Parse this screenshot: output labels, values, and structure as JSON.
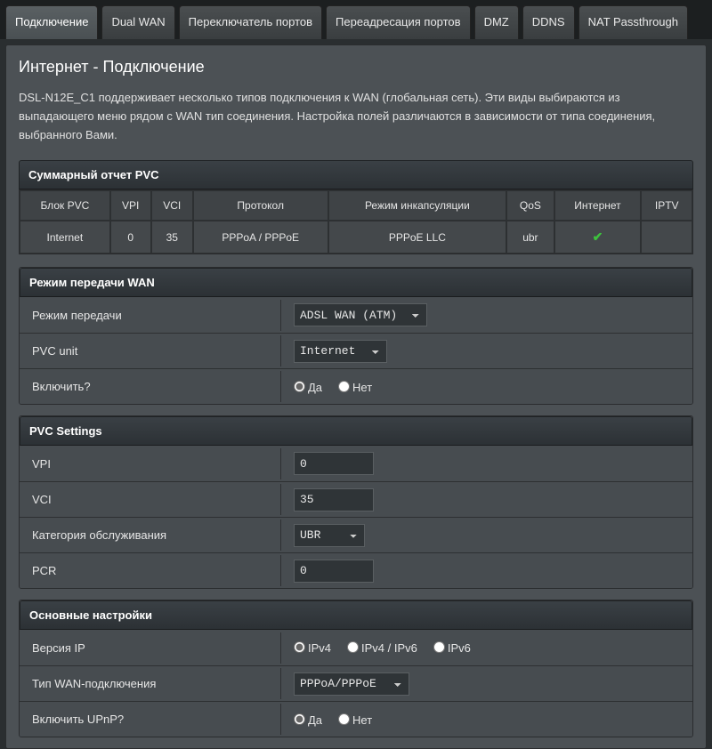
{
  "tabs": {
    "items": [
      "Подключение",
      "Dual WAN",
      "Переключатель портов",
      "Переадресация портов",
      "DMZ",
      "DDNS",
      "NAT Passthrough"
    ],
    "active_index": 0
  },
  "page": {
    "title": "Интернет - Подключение",
    "description": "DSL-N12E_C1 поддерживает несколько типов подключения к WAN (глобальная сеть). Эти виды выбираются из выпадающего меню рядом с WAN тип соединения. Настройка полей различаются в зависимости от типа соединения, выбранного Вами."
  },
  "summary": {
    "heading": "Суммарный отчет PVC",
    "columns": [
      "Блок PVC",
      "VPI",
      "VCI",
      "Протокол",
      "Режим инкапсуляции",
      "QoS",
      "Интернет",
      "IPTV"
    ],
    "row": {
      "block": "Internet",
      "vpi": "0",
      "vci": "35",
      "protocol": "PPPoA / PPPoE",
      "encap": "PPPoE LLC",
      "qos": "ubr",
      "internet_ok": true,
      "iptv": ""
    }
  },
  "wan_mode": {
    "heading": "Режим передачи WAN",
    "mode_label": "Режим передачи",
    "mode_value": "ADSL WAN (ATM)",
    "pvc_unit_label": "PVC unit",
    "pvc_unit_value": "Internet",
    "enable_label": "Включить?",
    "yes": "Да",
    "no": "Нет",
    "enable_value": "yes"
  },
  "pvc_settings": {
    "heading": "PVC Settings",
    "vpi_label": "VPI",
    "vpi_value": "0",
    "vci_label": "VCI",
    "vci_value": "35",
    "service_cat_label": "Категория обслуживания",
    "service_cat_value": "UBR",
    "pcr_label": "PCR",
    "pcr_value": "0"
  },
  "basic": {
    "heading": "Основные настройки",
    "ip_version_label": "Версия IP",
    "ip_options": [
      "IPv4",
      "IPv4 / IPv6",
      "IPv6"
    ],
    "ip_value": "IPv4",
    "wan_type_label": "Тип WAN-подключения",
    "wan_type_value": "PPPoA/PPPoE",
    "upnp_label": "Включить UPnP?",
    "yes": "Да",
    "no": "Нет",
    "upnp_value": "yes"
  }
}
